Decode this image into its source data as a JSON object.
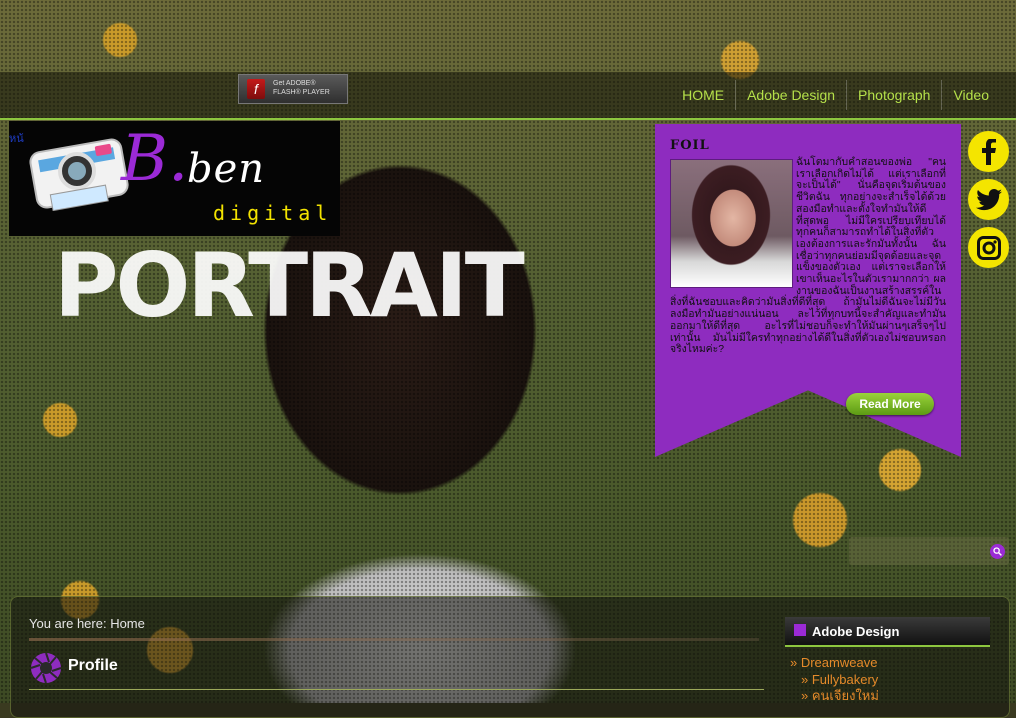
{
  "topbar": {
    "flash_badge": {
      "line1": "Get ADOBE®",
      "line2": "FLASH® PLAYER"
    }
  },
  "nav": {
    "items": [
      "HOME",
      "Adobe Design",
      "Photograph",
      "Video"
    ]
  },
  "logo": {
    "tab_label": "หน้",
    "letter": "B.",
    "word": "ben",
    "sub": "digital"
  },
  "hero": {
    "title": "PORTRAIT"
  },
  "profile_card": {
    "name": "FOIL",
    "text": "ฉันโตมากับคำสอนของพ่อ \"คนเราเลือกเกิดไม่ได้ แต่เราเลือกที่จะเป็นได้\" นั่นคือจุดเริ่มต้นของชีวิตฉัน ทุกอย่างจะสำเร็จได้ด้วยสองมือทำและตั้งใจทำมันให้ดีที่สุดพอ ไม่มีใครเปรียบเทียบได้ ทุกคนก็สามารถทำได้ในสิ่งที่ตัวเองต้องการและรักมันทั้งนั้น ฉันเชื่อว่าทุกคนย่อมมีจุดด้อยและจุดแข็งของตัวเอง แต่เราจะเลือกให้เขาเห็นอะไรในตัวเรามากกว่า ผลงานของฉันเป็นงานสร้างสรรค์ในสิ่งที่ฉันชอบและคิดว่ามันสิ่งที่ดีที่สุด ถ้ามันไม่ดีฉันจะไม่มีวันลงมือทำมันอย่างแน่นอน ละไว้ที่ทุกบทนี้จะสำคัญและทำมันออกมาให้ดีที่สุด อะไรที่ไม่ชอบก็จะทำให้มันผ่านๆเสร็จๆไปเท่านั้น มันไม่มีใครทำทุกอย่างได้ดีในสิ่งที่ตัวเองไม่ชอบหรอกจริงไหมค่ะ?",
    "read_more": "Read More"
  },
  "social": {
    "icons": [
      "facebook-icon",
      "twitter-icon",
      "instagram-icon"
    ],
    "color": "#f4e500"
  },
  "search": {
    "placeholder": ""
  },
  "breadcrumb": {
    "text": "You are here: Home"
  },
  "profile_section": {
    "title": "Profile"
  },
  "sidebar": {
    "heading": "Adobe Design",
    "items": [
      {
        "label": "» Dreamweave",
        "level": 1
      },
      {
        "label": "» Fullybakery",
        "level": 2
      },
      {
        "label": "» คนเจียงใหม่",
        "level": 2
      }
    ]
  },
  "colors": {
    "accent_green": "#8dc63f",
    "nav_text": "#b5e04a",
    "purple": "#8e2cbf",
    "link_orange": "#e58a2a"
  }
}
